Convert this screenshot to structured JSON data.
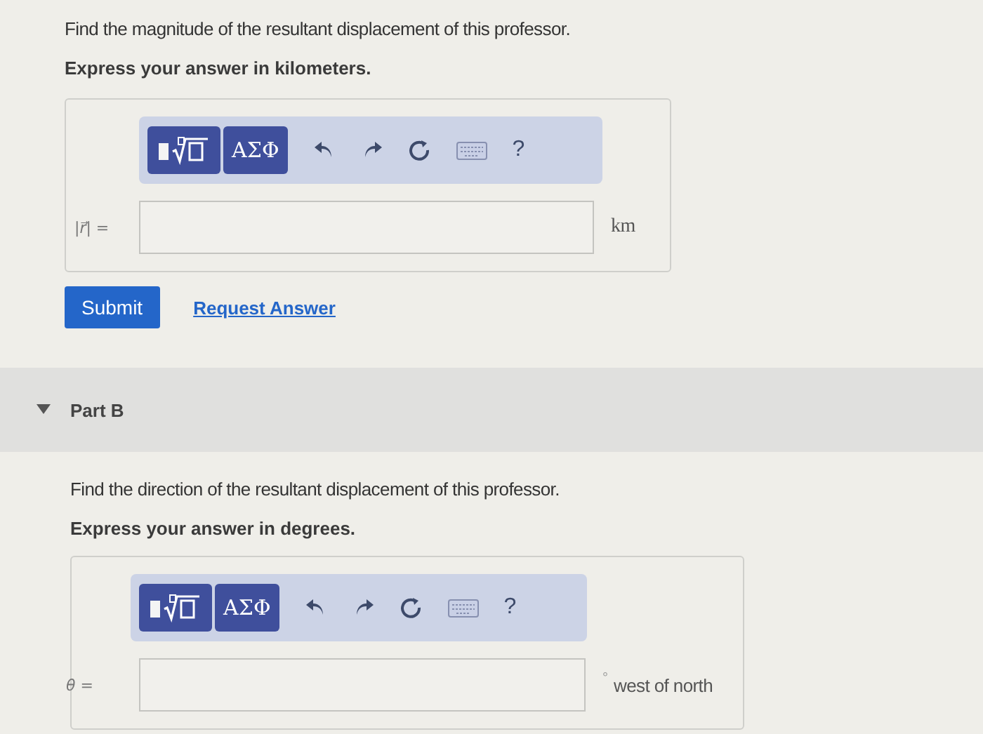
{
  "part_a": {
    "prompt": "Find the magnitude of the resultant displacement of this professor.",
    "instruction": "Express your answer in kilometers.",
    "toolbar": {
      "symbols_button": "ΑΣΦ",
      "help_button": "?"
    },
    "answer_label": "|r⃗| =",
    "unit": "km",
    "submit_button": "Submit",
    "request_link": "Request Answer"
  },
  "part_b": {
    "title": "Part B",
    "expanded": true,
    "prompt": "Find the direction of the resultant displacement of this professor.",
    "instruction": "Express your answer in degrees.",
    "toolbar": {
      "symbols_button": "ΑΣΦ",
      "help_button": "?"
    },
    "answer_label": "θ =",
    "unit_mark": "°",
    "unit": "west of north"
  }
}
